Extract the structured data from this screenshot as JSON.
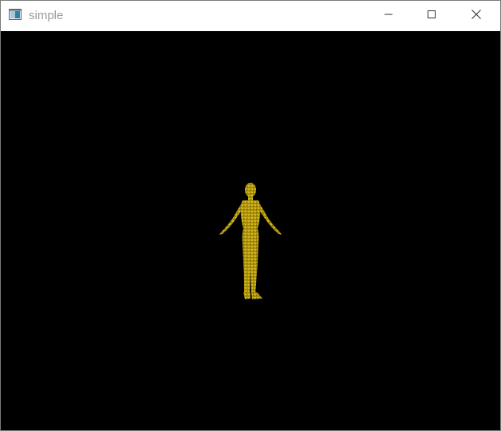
{
  "window": {
    "title": "simple",
    "minimize_icon": "minimize-icon",
    "maximize_icon": "maximize-icon",
    "close_icon": "close-icon",
    "app_icon": "app-window-icon"
  },
  "viewport": {
    "background_color": "#000000",
    "figure_color": "#b59a0a",
    "figure_highlight": "#d8bf28"
  }
}
